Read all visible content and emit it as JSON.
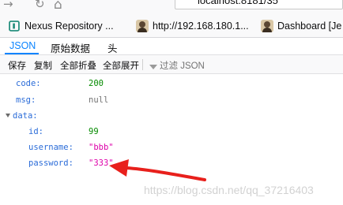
{
  "browser": {
    "url_text": "localhost:8181/35"
  },
  "bookmarks": [
    {
      "label": "Nexus Repository ...",
      "icon": "nexus-icon"
    },
    {
      "label": "http://192.168.180.1...",
      "icon": "jenkins-avatar-icon"
    },
    {
      "label": "Dashboard [Je",
      "icon": "jenkins-avatar-icon"
    }
  ],
  "tabs": [
    "JSON",
    "原始数据",
    "头"
  ],
  "toolbar": {
    "save": "保存",
    "copy": "复制",
    "collapse_all": "全部折叠",
    "expand_all": "全部展开",
    "filter_placeholder": "过滤 JSON"
  },
  "json": {
    "code_key": "code:",
    "code_val": "200",
    "msg_key": "msg:",
    "msg_val": "null",
    "data_key": "data:",
    "id_key": "id:",
    "id_val": "99",
    "username_key": "username:",
    "username_val": "\"bbb\"",
    "password_key": "password:",
    "password_val": "\"333\""
  },
  "watermark": "https://blog.csdn.net/qq_37216403",
  "colors": {
    "accent": "#0a84ff",
    "json_key": "#2b6cd8",
    "json_number": "#058b00",
    "json_string": "#dd00a9",
    "annotation_arrow": "#e8201c"
  }
}
